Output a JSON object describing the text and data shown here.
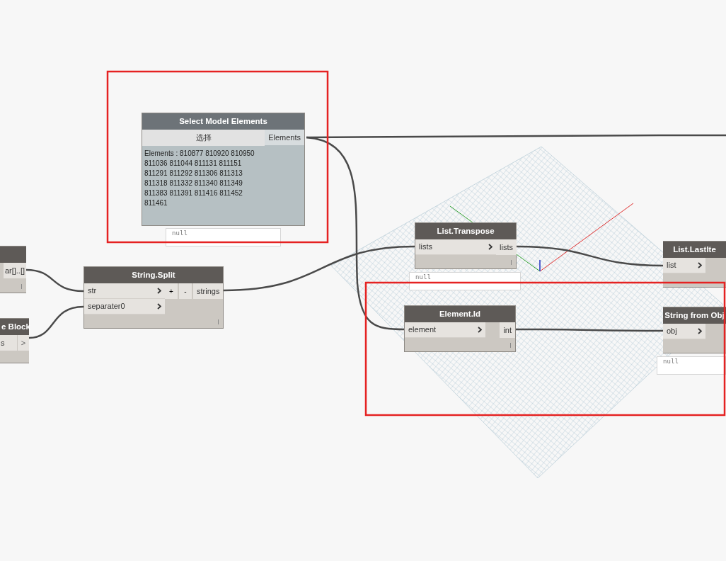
{
  "nodes": [
    {
      "kind": "partial",
      "outputs": [
        "ar[]..[]"
      ]
    },
    {
      "kind": "code",
      "title": "e Block",
      "code": "s",
      "outputs": [
        ">"
      ]
    },
    {
      "kind": "select",
      "title": "Select Model Elements",
      "button": "选择",
      "outputs": [
        "Elements"
      ],
      "text": "Elements : 810877 810920 810950\n811036 811044 811131 811151\n811291 811292 811306 811313\n811318 811332 811340 811349\n811383 811391 811416 811452\n811461",
      "preview": "null"
    },
    {
      "kind": "function",
      "title": "String.Split",
      "inputs": [
        "str",
        "separater0"
      ],
      "list_buttons": [
        "+",
        "-"
      ],
      "outputs": [
        "strings"
      ]
    },
    {
      "kind": "function",
      "title": "List.Transpose",
      "inputs": [
        "lists"
      ],
      "outputs": [
        "lists"
      ],
      "preview": "null"
    },
    {
      "kind": "function",
      "title": "Element.Id",
      "inputs": [
        "element"
      ],
      "outputs": [
        "int"
      ]
    },
    {
      "kind": "function",
      "title": "List.LastIte",
      "inputs": [
        "list"
      ]
    },
    {
      "kind": "function",
      "title": "String from Obj",
      "inputs": [
        "obj"
      ],
      "preview": "null"
    }
  ]
}
